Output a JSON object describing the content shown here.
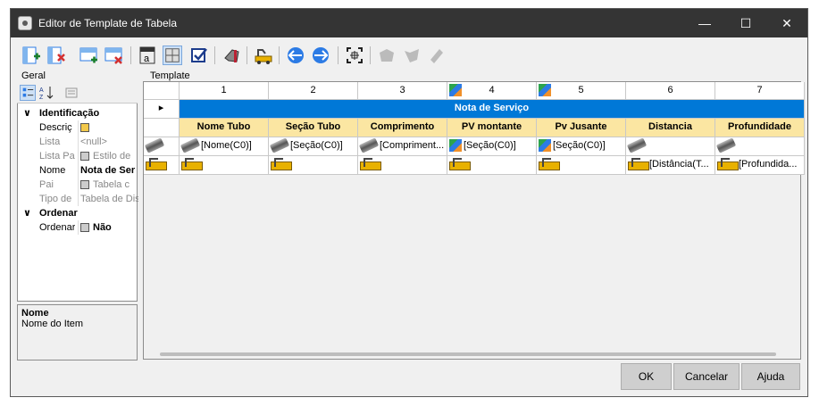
{
  "window": {
    "title": "Editor de Template de Tabela",
    "minimize": "—",
    "maximize": "☐",
    "close": "✕"
  },
  "toolbar": {
    "section_label": "Geral"
  },
  "template_label": "Template",
  "properties": {
    "rows": [
      {
        "type": "category",
        "label": "Identificação",
        "toggle": "∨"
      },
      {
        "type": "prop",
        "name": "Descriç",
        "value": "",
        "value_icon": "edit-icon",
        "disabled": false
      },
      {
        "type": "prop",
        "name": "Lista",
        "value": "<null>",
        "disabled": true
      },
      {
        "type": "prop",
        "name": "Lista Pa",
        "value": "Estilo de",
        "value_icon": "table-icon",
        "disabled": true
      },
      {
        "type": "prop",
        "name": "Nome",
        "value": "Nota de Ser",
        "bold": true,
        "disabled": false
      },
      {
        "type": "prop",
        "name": "Pai",
        "value": "Tabela c",
        "value_icon": "table-icon",
        "disabled": true
      },
      {
        "type": "prop",
        "name": "Tipo de",
        "value": "Tabela de Dis",
        "disabled": true
      },
      {
        "type": "category",
        "label": "Ordenar",
        "toggle": "∨"
      },
      {
        "type": "prop",
        "name": "Ordenar",
        "value": "Não",
        "bold": true,
        "value_icon": "checkbox-icon",
        "disabled": false
      }
    ]
  },
  "description": {
    "title": "Nome",
    "text": "Nome do Item"
  },
  "grid": {
    "row_marker": "▸",
    "columns": [
      "1",
      "2",
      "3",
      "4",
      "5",
      "6",
      "7"
    ],
    "column_icons": [
      "",
      "",
      "",
      "cube-icon",
      "cube-icon",
      "",
      ""
    ],
    "banner": "Nota de Serviço",
    "headers": [
      "Nome Tubo",
      "Seção Tubo",
      "Comprimento",
      "PV montante",
      "Pv Jusante",
      "Distancia",
      "Profundidade"
    ],
    "row1": [
      {
        "icon": "pipe",
        "text": "[Nome(C0)]"
      },
      {
        "icon": "pipe",
        "text": "[Seção(C0)]"
      },
      {
        "icon": "pipe",
        "text": "[Compriment..."
      },
      {
        "icon": "cube",
        "text": "[Seção(C0)]"
      },
      {
        "icon": "cube",
        "text": "[Seção(C0)]"
      },
      {
        "icon": "pipe",
        "text": ""
      },
      {
        "icon": "pipe",
        "text": ""
      }
    ],
    "row2": [
      {
        "icon": "dig",
        "text": ""
      },
      {
        "icon": "dig",
        "text": ""
      },
      {
        "icon": "dig",
        "text": ""
      },
      {
        "icon": "dig",
        "text": ""
      },
      {
        "icon": "dig",
        "text": ""
      },
      {
        "icon": "dig",
        "text": "[Distância(T..."
      },
      {
        "icon": "dig",
        "text": "[Profundida..."
      }
    ],
    "row1_leader_icon": "pipe",
    "row2_leader_icon": "dig"
  },
  "buttons": {
    "ok": "OK",
    "cancel": "Cancelar",
    "help": "Ajuda"
  }
}
